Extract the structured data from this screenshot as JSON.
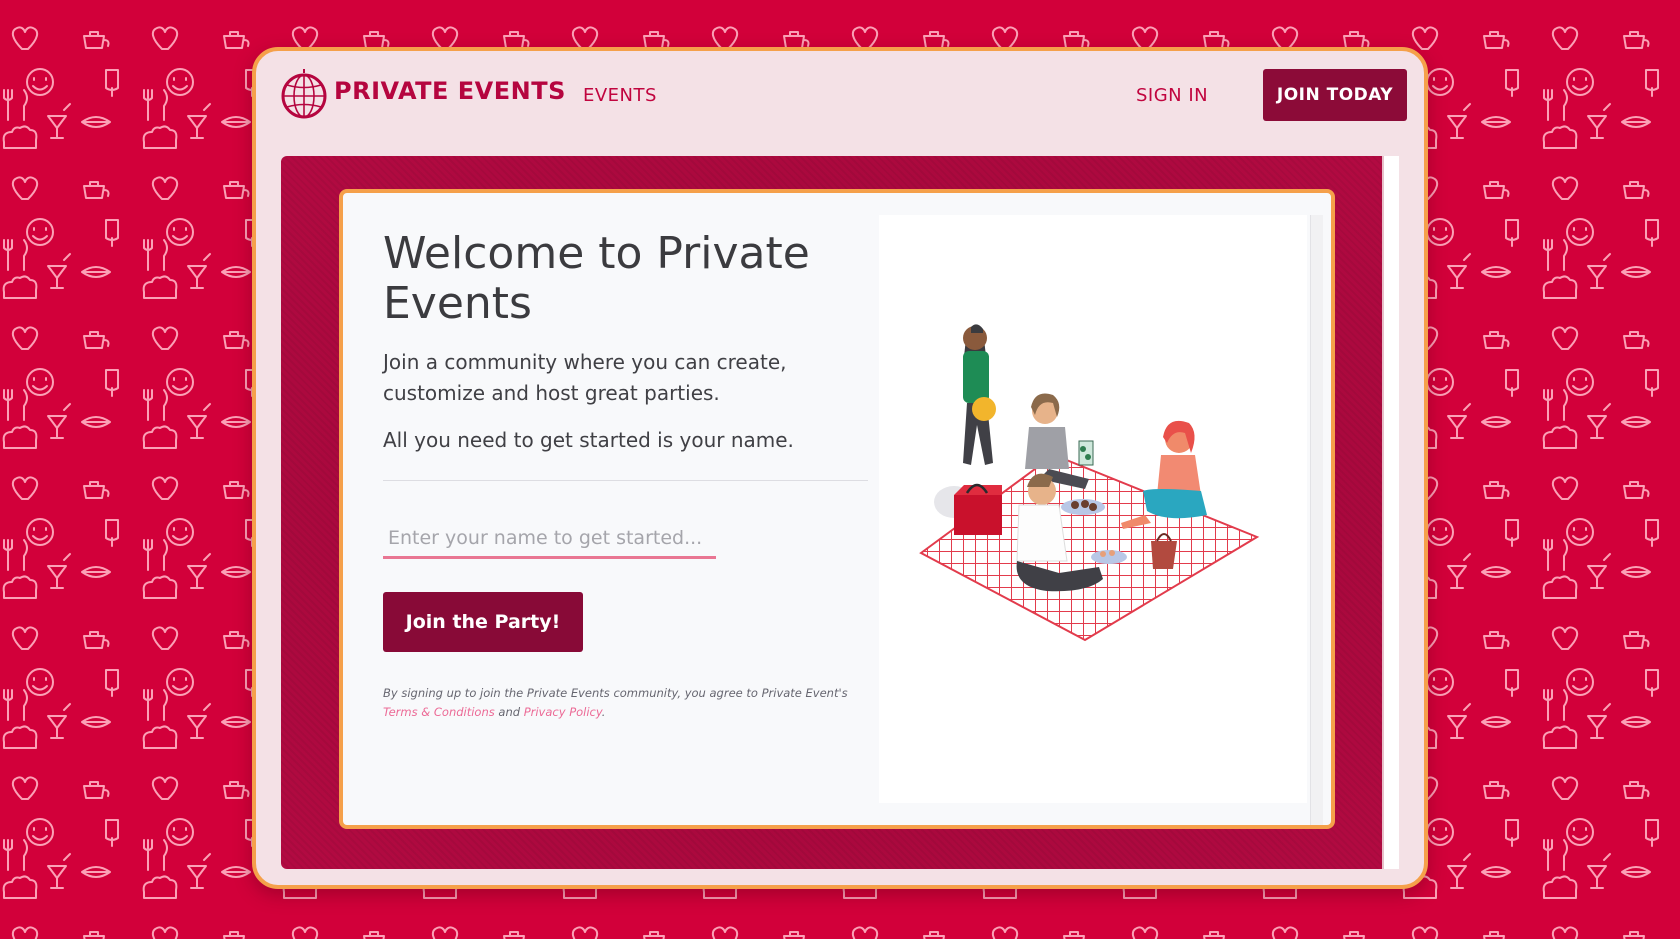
{
  "nav": {
    "brand": "PRIVATE EVENTS",
    "events_link": "EVENTS",
    "sign_in": "SIGN IN",
    "join_today": "JOIN TODAY"
  },
  "hero": {
    "title": "Welcome to Private Events",
    "intro": "Join a community where you can create, customize and host great parties.",
    "intro2": "All you need to get started is your name.",
    "name_placeholder": "Enter your name to get started...",
    "cta": "Join the Party!",
    "legal_prefix": "By signing up to join the Private Events community, you agree to Private Event's",
    "terms_link": "Terms & Conditions",
    "legal_and": "and",
    "privacy_link": "Privacy Policy",
    "legal_suffix": "."
  },
  "icons": {
    "logo": "disco-ball-icon",
    "illustration": "picnic-illustration",
    "pattern": [
      "heart-icon",
      "teapot-icon",
      "cocktail-icon",
      "ice-pop-icon",
      "fork-knife-icon",
      "smiley-icon",
      "hotdog-icon",
      "chef-hat-icon"
    ]
  },
  "colors": {
    "background": "#d2003a",
    "frame_border": "#f5a04a",
    "frame_bg": "#f4e1e6",
    "brand": "#b5053f",
    "button": "#8c0b38",
    "panel": "#a2083a",
    "input_underline": "#e97693",
    "link": "#ec6a96"
  }
}
